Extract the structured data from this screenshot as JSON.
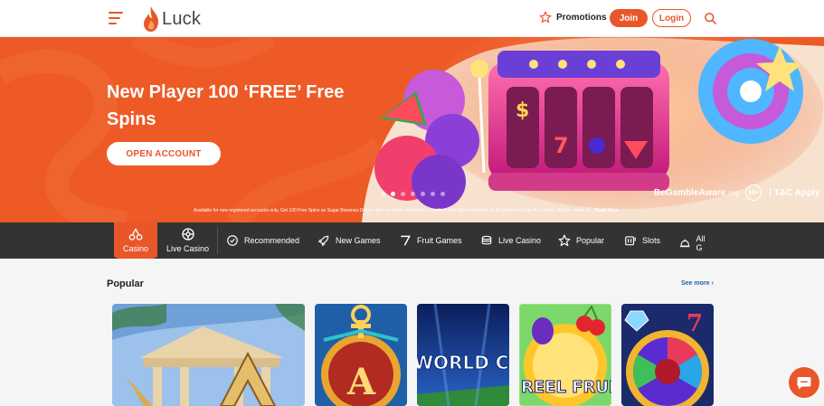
{
  "header": {
    "logo_text": "Luck",
    "promotions_label": "Promotions",
    "join_label": "Join",
    "login_label": "Login"
  },
  "hero": {
    "title": "New Player 100 ‘FREE’ Free Spins",
    "cta_label": "OPEN ACCOUNT",
    "disclaimer": "Available for new registered accounts only. Get 100 Free Spins on Sugar Bonanza Deluxe after complete registration, credited after login in batches of 20 spins every day for 5 days. £5 Max. stake wi...",
    "read_more": "Read More",
    "gamble_aware": "BeGambleAware",
    "gamble_aware_suffix": ".org",
    "age_badge": "18+",
    "tc_label": "T&C Apply",
    "slide_count": 7,
    "active_slide": 2
  },
  "categories": {
    "active": {
      "label": "Casino",
      "icon": "cherries-icon"
    },
    "live": {
      "label": "Live Casino",
      "icon": "roulette-icon"
    },
    "items": [
      {
        "label": "Recommended",
        "icon": "check-badge-icon"
      },
      {
        "label": "New Games",
        "icon": "rocket-icon"
      },
      {
        "label": "Fruit Games",
        "icon": "seven-icon"
      },
      {
        "label": "Live Casino",
        "icon": "chips-icon"
      },
      {
        "label": "Popular",
        "icon": "star-icon"
      },
      {
        "label": "Slots",
        "icon": "slot-machine-icon"
      },
      {
        "label": "All G",
        "icon": "bell-icon"
      }
    ]
  },
  "popular": {
    "title": "Popular",
    "see_more": "See more",
    "games": [
      {
        "title": "",
        "theme": "greek-temple"
      },
      {
        "title": "",
        "theme": "egyptian-a"
      },
      {
        "title": "WORLD CUP GOLD",
        "theme": "football"
      },
      {
        "title": "REEL FRUITY",
        "theme": "fruit"
      },
      {
        "title": "",
        "theme": "wheel"
      }
    ]
  },
  "colors": {
    "brand": "#e8562a",
    "dark_bar": "#333333"
  }
}
